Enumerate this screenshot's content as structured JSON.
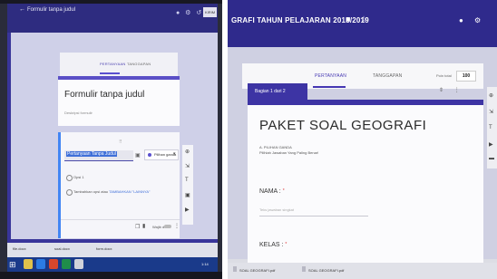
{
  "left_photo": {
    "window_title": "Formulir tanpa judul",
    "top_icons": "● ⚙ ↺",
    "kirim_label": "KIRIM",
    "tabs": [
      {
        "label": "PERTANYAAN",
        "active": true
      },
      {
        "label": "TANGGAPAN",
        "active": false
      }
    ],
    "form_title": "Formulir tanpa judul",
    "form_description": "Deskripsi formulir",
    "question": {
      "title": "Pertanyaan Tanpa Judul",
      "type_label": "Pilihan ganda",
      "options": [
        "Opsi 1"
      ],
      "add_option_prefix": "Tambahkan opsi atau",
      "add_option_link": "TAMBAHKAN \"LAINNYA\"",
      "required_label": "Wajib diisi"
    },
    "downloads": [
      "file.docx",
      "soal.docx",
      "form.docx"
    ],
    "taskbar_clock": "1:14"
  },
  "right_photo": {
    "window_title": "GRAFI TAHUN PELAJARAN 2018/2019",
    "tabs": [
      {
        "label": "PERTANYAAN",
        "active": true
      },
      {
        "label": "TANGGAPAN",
        "active": false
      }
    ],
    "total_points_label": "Poin total",
    "total_points_value": "100",
    "section_label": "Bagian 1 dari 2",
    "form_title": "PAKET SOAL GEOGRAFI",
    "desc_line1": "A. PILIHAN GANDA",
    "desc_line2": "Pilihlah Jawaban Yang Paling Benar!",
    "q1_label": "NAMA :",
    "q1_placeholder": "Teks jawaban singkat",
    "q2_label": "KELAS :",
    "required_mark": "*",
    "downloads": [
      "SOAL GEOGRAFI.pdf",
      "SOAL GEOGRAFI.pdf"
    ]
  },
  "colors": {
    "google_forms_purple": "#3d34a4",
    "monitor_blue": "#2f2a8c",
    "taskbar_blue": "#1a3a8a"
  }
}
